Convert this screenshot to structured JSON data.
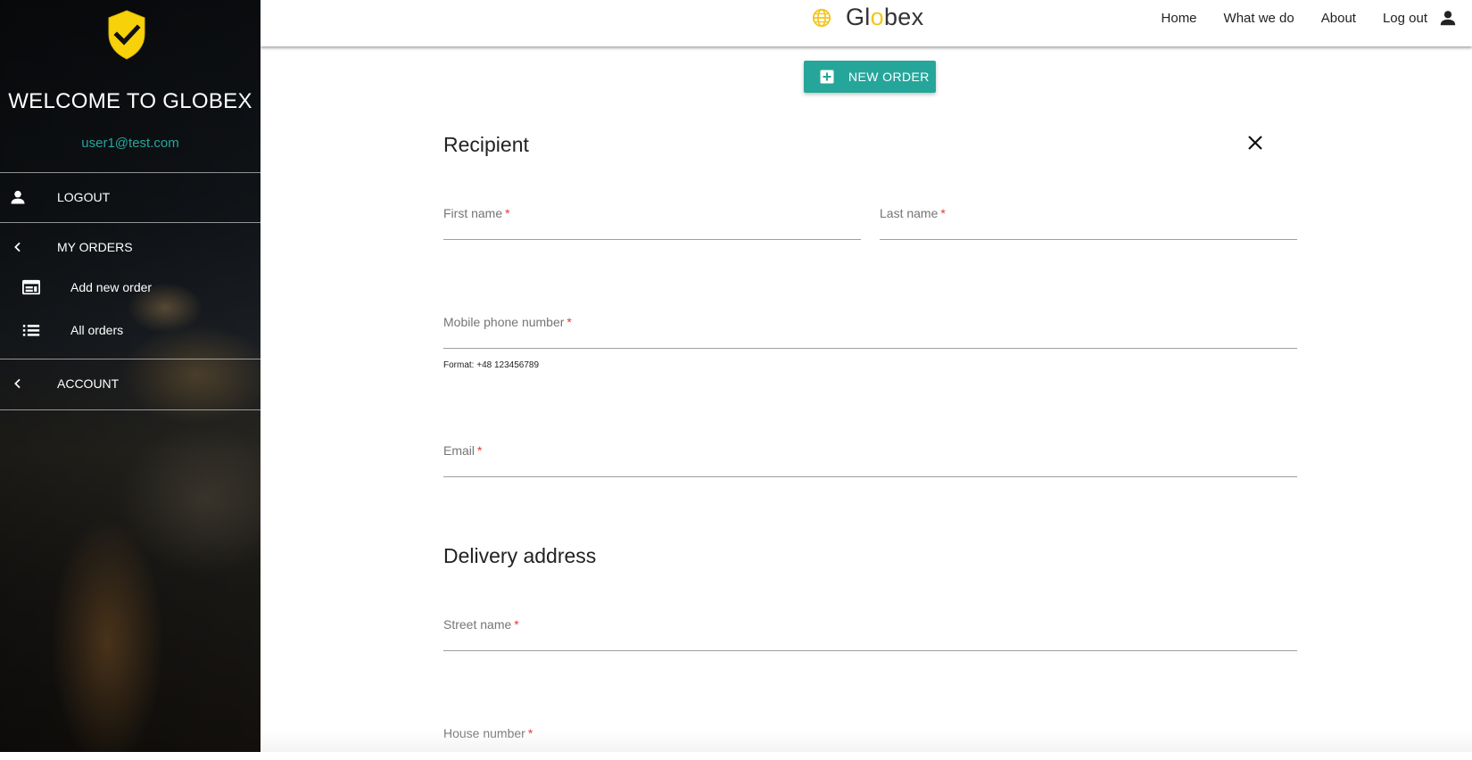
{
  "sidebar": {
    "welcome": "WELCOME TO GLOBEX",
    "email": "user1@test.com",
    "logout_label": "LOGOUT",
    "my_orders_label": "MY ORDERS",
    "add_new_order_label": "Add new order",
    "all_orders_label": "All orders",
    "account_label": "ACCOUNT"
  },
  "header": {
    "brand_prefix": "Gl",
    "brand_accent": "o",
    "brand_suffix": "bex",
    "nav": {
      "home": "Home",
      "what_we_do": "What we do",
      "about": "About",
      "log_out": "Log out"
    }
  },
  "main": {
    "new_order_button": "NEW ORDER",
    "recipient_title": "Recipient",
    "delivery_title": "Delivery address",
    "fields": {
      "first_name": {
        "label": "First name",
        "value": ""
      },
      "last_name": {
        "label": "Last name",
        "value": ""
      },
      "mobile_phone": {
        "label": "Mobile phone number",
        "value": "",
        "hint": "Format: +48 123456789"
      },
      "email": {
        "label": "Email",
        "value": ""
      },
      "street_name": {
        "label": "Street name",
        "value": ""
      },
      "house_number": {
        "label": "House number",
        "value": ""
      }
    },
    "required_marker": "*"
  },
  "colors": {
    "accent": "#26a69a",
    "brand_yellow": "#f5c518",
    "required": "#e53935"
  },
  "icons": {
    "shield": "shield-check-icon",
    "globe": "globe-icon",
    "person": "person-icon",
    "chevron": "chevron-left-icon",
    "add_order": "web-card-icon",
    "list": "list-icon",
    "close": "close-icon",
    "add_box": "add-box-icon"
  }
}
